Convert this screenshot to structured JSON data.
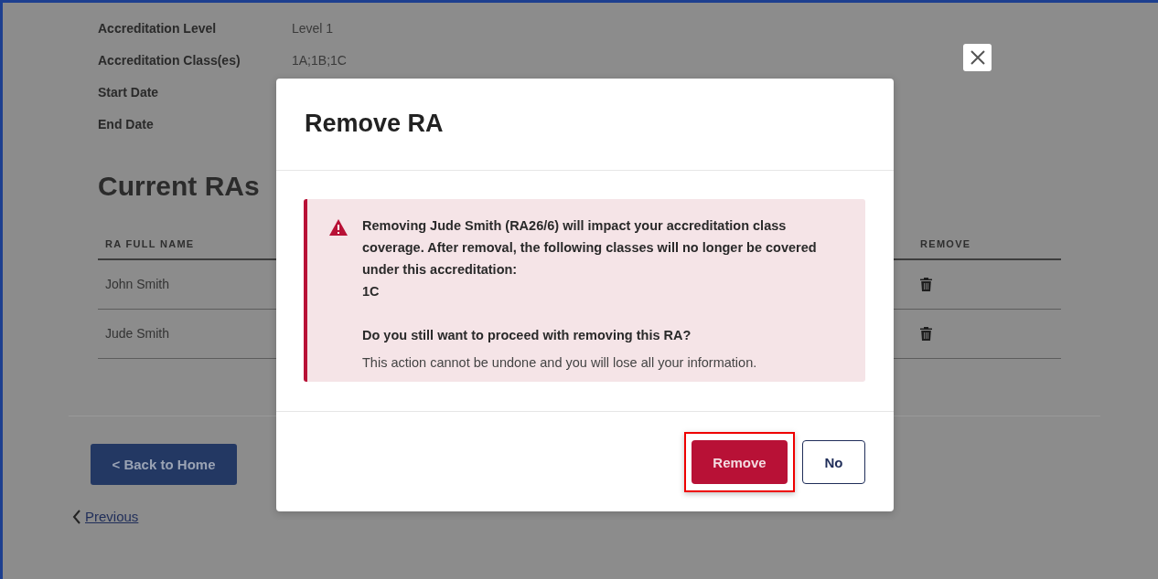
{
  "details": [
    {
      "label": "Accreditation Level",
      "value": "Level 1"
    },
    {
      "label": "Accreditation Class(es)",
      "value": "1A;1B;1C"
    },
    {
      "label": "Start Date"
    },
    {
      "label": "End Date"
    }
  ],
  "section_title": "Current RAs",
  "table": {
    "columns": [
      "RA FULL NAME",
      "REMOVE"
    ],
    "rows": [
      {
        "name": "John Smith"
      },
      {
        "name": "Jude Smith"
      }
    ]
  },
  "back_button": "< Back to Home",
  "previous_link": "Previous",
  "modal": {
    "title": "Remove RA",
    "alert": {
      "message": "Removing Jude Smith (RA26/6) will impact your accreditation class coverage. After removal, the following classes will no longer be covered under this accreditation:",
      "classes": "1C",
      "question": "Do you still want to proceed with removing this RA?",
      "note": "This action cannot be undone and you will lose all your information."
    },
    "buttons": [
      {
        "label": "Remove",
        "kind": "primary",
        "highlighted": true
      },
      {
        "label": "No",
        "kind": "secondary",
        "highlighted": false
      }
    ]
  }
}
